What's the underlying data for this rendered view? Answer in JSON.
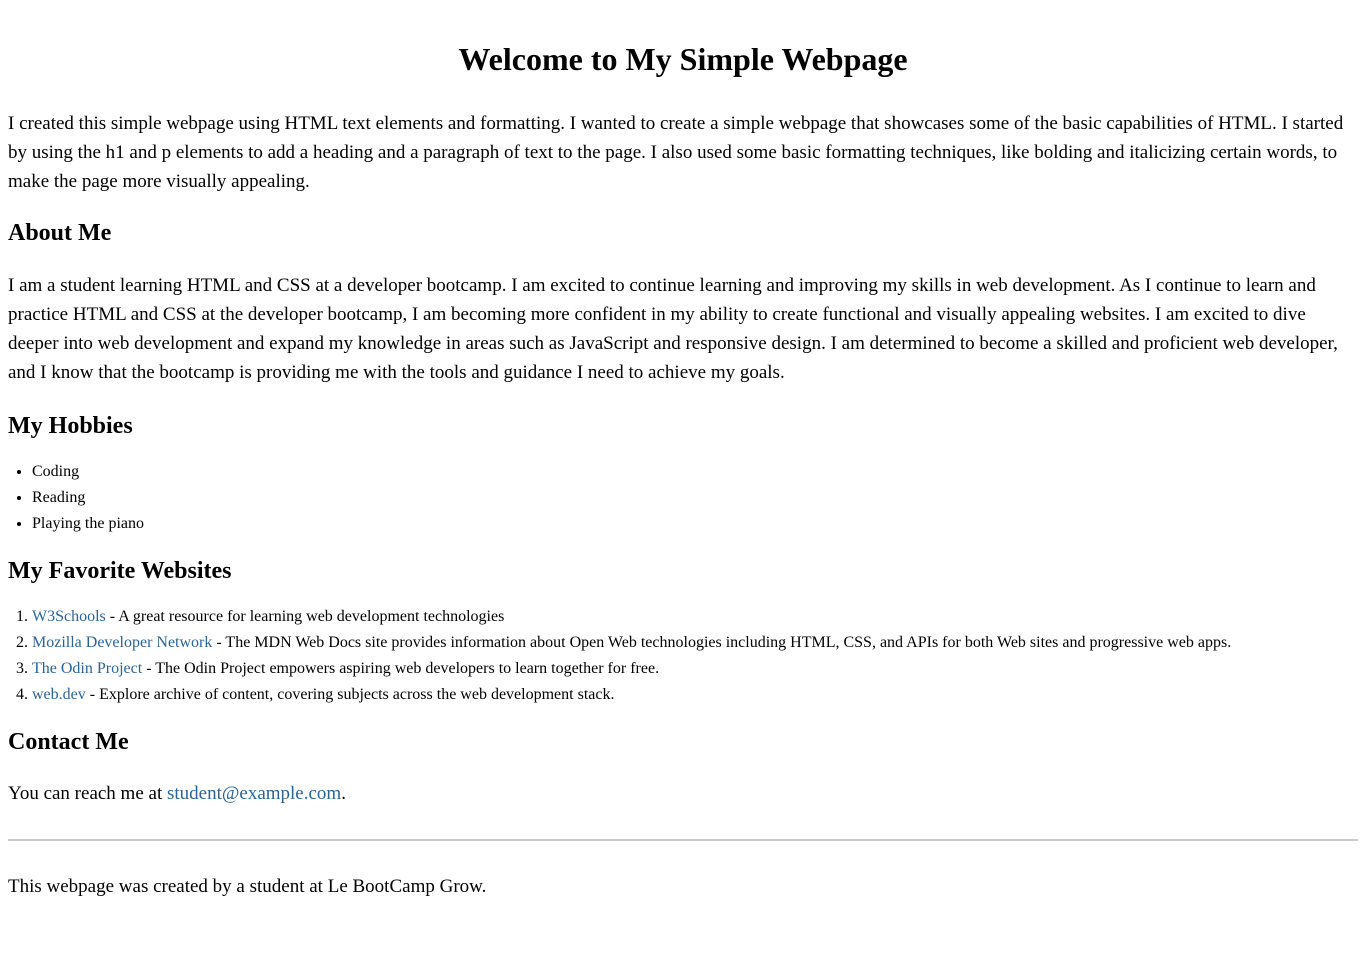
{
  "title": "Welcome to My Simple Webpage",
  "intro": "I created this simple webpage using HTML text elements and formatting. I wanted to create a simple webpage that showcases some of the basic capabilities of HTML. I started by using the h1 and p elements to add a heading and a paragraph of text to the page. I also used some basic formatting techniques, like bolding and italicizing certain words, to make the page more visually appealing.",
  "about": {
    "heading": "About Me",
    "text": "I am a student learning HTML and CSS at a developer bootcamp. I am excited to continue learning and improving my skills in web development. As I continue to learn and practice HTML and CSS at the developer bootcamp, I am becoming more confident in my ability to create functional and visually appealing websites. I am excited to dive deeper into web development and expand my knowledge in areas such as JavaScript and responsive design. I am determined to become a skilled and proficient web developer, and I know that the bootcamp is providing me with the tools and guidance I need to achieve my goals."
  },
  "hobbies": {
    "heading": "My Hobbies",
    "items": [
      "Coding",
      "Reading",
      "Playing the piano"
    ]
  },
  "websites": {
    "heading": "My Favorite Websites",
    "items": [
      {
        "link": "W3Schools",
        "desc": " - A great resource for learning web development technologies"
      },
      {
        "link": "Mozilla Developer Network",
        "desc": " - The MDN Web Docs site provides information about Open Web technologies including HTML, CSS, and APIs for both Web sites and progressive web apps."
      },
      {
        "link": "The Odin Project",
        "desc": " - The Odin Project empowers aspiring web developers to learn together for free."
      },
      {
        "link": "web.dev",
        "desc": " - Explore archive of content, covering subjects across the web development stack."
      }
    ]
  },
  "contact": {
    "heading": "Contact Me",
    "prefix": "You can reach me at ",
    "email": "student@example.com",
    "suffix": "."
  },
  "footer": "This webpage was created by a student at Le BootCamp Grow.",
  "colors": {
    "link": "#2a6496",
    "divider": "#c8c8c8"
  }
}
